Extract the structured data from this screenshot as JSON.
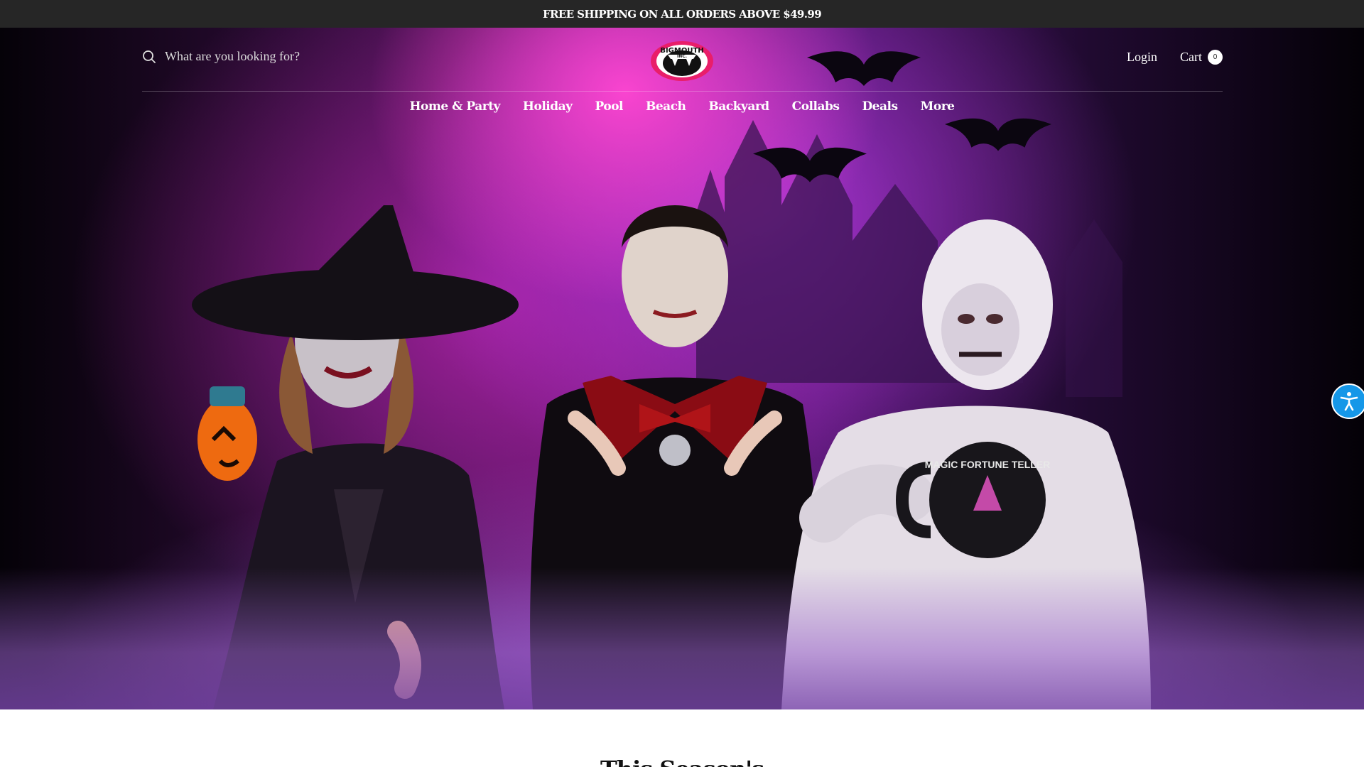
{
  "announcement": {
    "text": "FREE SHIPPING ON ALL ORDERS ABOVE $49.99"
  },
  "header": {
    "search_placeholder": "What are you looking for?",
    "logo_text": [
      "BIGMOUTH",
      "INC."
    ],
    "login_label": "Login",
    "cart_label": "Cart",
    "cart_count": "0"
  },
  "nav": {
    "items": [
      "Home & Party",
      "Holiday",
      "Pool",
      "Beach",
      "Backyard",
      "Collabs",
      "Deals",
      "More"
    ]
  },
  "hero": {
    "mug_text": "MAGIC FORTUNE TELLER"
  },
  "section": {
    "heading": "This Season's"
  },
  "colors": {
    "announcement_bg": "#262626",
    "hero_accent_pink": "#ff46d2",
    "hero_accent_purple": "#af37dc",
    "accessibility_button": "#1597e8"
  },
  "icons": [
    "search-icon",
    "logo-icon",
    "bat-icon",
    "accessibility-icon"
  ]
}
